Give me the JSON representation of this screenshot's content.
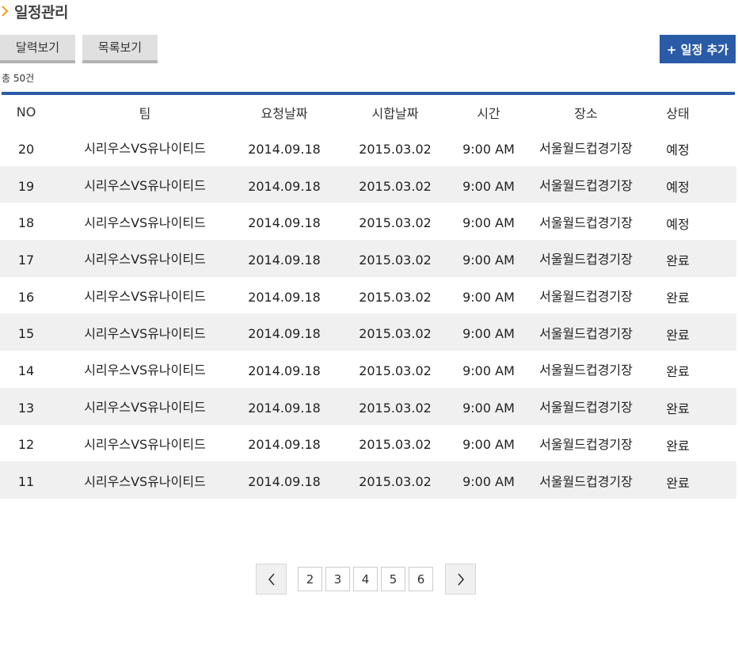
{
  "page": {
    "title": "일정관리"
  },
  "toolbar": {
    "calendar_view_label": "달력보기",
    "list_view_label": "목록보기",
    "add_schedule_label": "+ 일정 추가"
  },
  "summary": {
    "total_label": "총 50건"
  },
  "table": {
    "headers": [
      "NO",
      "팀",
      "요청날짜",
      "시합날짜",
      "시간",
      "장소",
      "상태"
    ],
    "rows": [
      {
        "no": "20",
        "team": "시리우스VS유나이티드",
        "request_date": "2014.09.18",
        "match_date": "2015.03.02",
        "time": "9:00 AM",
        "venue": "서울월드컵경기장",
        "status": "예정"
      },
      {
        "no": "19",
        "team": "시리우스VS유나이티드",
        "request_date": "2014.09.18",
        "match_date": "2015.03.02",
        "time": "9:00 AM",
        "venue": "서울월드컵경기장",
        "status": "예정"
      },
      {
        "no": "18",
        "team": "시리우스VS유나이티드",
        "request_date": "2014.09.18",
        "match_date": "2015.03.02",
        "time": "9:00 AM",
        "venue": "서울월드컵경기장",
        "status": "예정"
      },
      {
        "no": "17",
        "team": "시리우스VS유나이티드",
        "request_date": "2014.09.18",
        "match_date": "2015.03.02",
        "time": "9:00 AM",
        "venue": "서울월드컵경기장",
        "status": "완료"
      },
      {
        "no": "16",
        "team": "시리우스VS유나이티드",
        "request_date": "2014.09.18",
        "match_date": "2015.03.02",
        "time": "9:00 AM",
        "venue": "서울월드컵경기장",
        "status": "완료"
      },
      {
        "no": "15",
        "team": "시리우스VS유나이티드",
        "request_date": "2014.09.18",
        "match_date": "2015.03.02",
        "time": "9:00 AM",
        "venue": "서울월드컵경기장",
        "status": "완료"
      },
      {
        "no": "14",
        "team": "시리우스VS유나이티드",
        "request_date": "2014.09.18",
        "match_date": "2015.03.02",
        "time": "9:00 AM",
        "venue": "서울월드컵경기장",
        "status": "완료"
      },
      {
        "no": "13",
        "team": "시리우스VS유나이티드",
        "request_date": "2014.09.18",
        "match_date": "2015.03.02",
        "time": "9:00 AM",
        "venue": "서울월드컵경기장",
        "status": "완료"
      },
      {
        "no": "12",
        "team": "시리우스VS유나이티드",
        "request_date": "2014.09.18",
        "match_date": "2015.03.02",
        "time": "9:00 AM",
        "venue": "서울월드컵경기장",
        "status": "완료"
      },
      {
        "no": "11",
        "team": "시리우스VS유나이티드",
        "request_date": "2014.09.18",
        "match_date": "2015.03.02",
        "time": "9:00 AM",
        "venue": "서울월드컵경기장",
        "status": "완료"
      }
    ]
  },
  "pagination": {
    "prev_icon": "chevron-left-icon",
    "next_icon": "chevron-right-icon",
    "pages": [
      "2",
      "3",
      "4",
      "5",
      "6"
    ]
  },
  "icons": {
    "heading": "chevron-right-icon"
  },
  "colors": {
    "accent": "#2a5ba7",
    "heading_icon": "#f39c12",
    "row_alt": "#f0f0f0",
    "tab_bg": "#e0e0e0"
  }
}
